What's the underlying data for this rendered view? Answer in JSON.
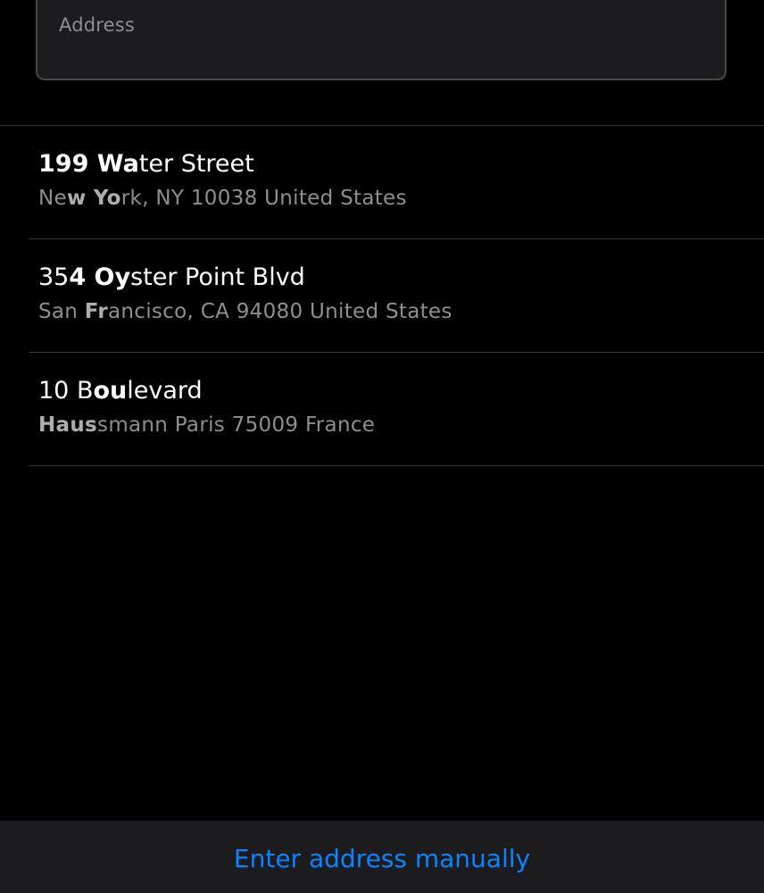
{
  "search": {
    "placeholder": "Address"
  },
  "results": [
    {
      "line1": [
        {
          "text": "199 Wa",
          "bold": true
        },
        {
          "text": "ter Street",
          "bold": false
        }
      ],
      "line2": [
        {
          "text": "Ne",
          "bold": false
        },
        {
          "text": "w Yo",
          "bold": true
        },
        {
          "text": "rk, NY 10038 United States",
          "bold": false
        }
      ]
    },
    {
      "line1": [
        {
          "text": "35",
          "bold": false
        },
        {
          "text": "4 Oy",
          "bold": true
        },
        {
          "text": "ster Point Blvd",
          "bold": false
        }
      ],
      "line2": [
        {
          "text": "San ",
          "bold": false
        },
        {
          "text": "Fr",
          "bold": true
        },
        {
          "text": "ancisco, CA 94080 United States",
          "bold": false
        }
      ]
    },
    {
      "line1": [
        {
          "text": "10 B",
          "bold": false
        },
        {
          "text": "ou",
          "bold": true
        },
        {
          "text": "levard",
          "bold": false
        }
      ],
      "line2": [
        {
          "text": "Haus",
          "bold": true
        },
        {
          "text": "smann Paris 75009 France",
          "bold": false
        }
      ]
    }
  ],
  "footer": {
    "manual_label": "Enter address manually"
  },
  "colors": {
    "background": "#000000",
    "field_background": "#1c1c1e",
    "accent": "#0a84ff",
    "secondary_text": "#8e8e93"
  }
}
